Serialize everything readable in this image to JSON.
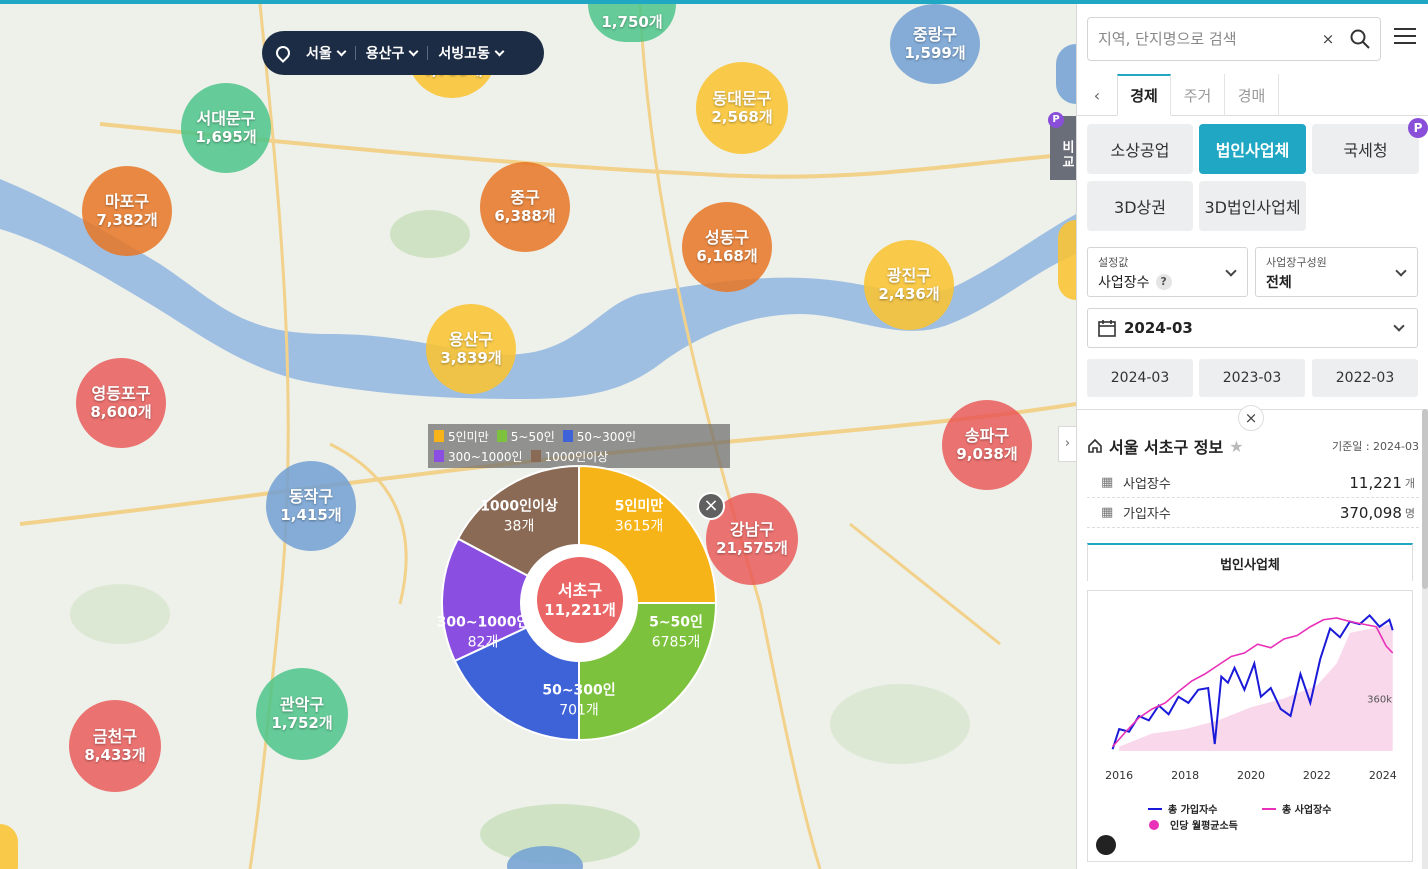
{
  "location": {
    "city": "서울",
    "district": "용산구",
    "dong": "서빙고동"
  },
  "map_bubbles": [
    {
      "name": "서대문구",
      "count": "1,695개",
      "color": "green"
    },
    {
      "name": "마포구",
      "count": "7,382개",
      "color": "orange"
    },
    {
      "name": "중구",
      "count": "6,388개",
      "color": "orange"
    },
    {
      "name": "동대문구",
      "count": "2,568개",
      "color": "yellow"
    },
    {
      "name": "성동구",
      "count": "6,168개",
      "color": "orange"
    },
    {
      "name": "중랑구",
      "count": "1,599개",
      "color": "blue"
    },
    {
      "name": "광진구",
      "count": "2,436개",
      "color": "yellow"
    },
    {
      "name": "용산구",
      "count": "3,839개",
      "color": "yellow"
    },
    {
      "name": "영등포구",
      "count": "8,600개",
      "color": "red"
    },
    {
      "name": "송파구",
      "count": "9,038개",
      "color": "red"
    },
    {
      "name": "동작구",
      "count": "1,415개",
      "color": "blue"
    },
    {
      "name": "강남구",
      "count": "21,575개",
      "color": "red"
    },
    {
      "name": "관악구",
      "count": "1,752개",
      "color": "green"
    },
    {
      "name": "금천구",
      "count": "8,433개",
      "color": "red"
    },
    {
      "name": "",
      "count": "4,785개",
      "color": "yellow"
    },
    {
      "name": "",
      "count": "1,750개",
      "color": "green"
    }
  ],
  "legend": [
    {
      "label": "5인미만",
      "color": "#f6b418"
    },
    {
      "label": "5~50인",
      "color": "#7cc23c"
    },
    {
      "label": "50~300인",
      "color": "#3e62d8"
    },
    {
      "label": "300~1000인",
      "color": "#8a4fe0"
    },
    {
      "label": "1000인이상",
      "color": "#8b6a55"
    }
  ],
  "donut": {
    "district": "서초구",
    "total": "11,221개",
    "segments": [
      {
        "label": "5인미만",
        "value_text": "3615개",
        "value": 3615,
        "color": "#f6b418"
      },
      {
        "label": "5~50인",
        "value_text": "6785개",
        "value": 6785,
        "color": "#7cc23c"
      },
      {
        "label": "50~300인",
        "value_text": "701개",
        "value": 701,
        "color": "#3e62d8"
      },
      {
        "label": "300~1000인",
        "value_text": "82개",
        "value": 82,
        "color": "#8a4fe0"
      },
      {
        "label": "1000인이상",
        "value_text": "38개",
        "value": 38,
        "color": "#8b6a55"
      }
    ]
  },
  "compare_label": "비교",
  "search": {
    "placeholder": "지역, 단지명으로 검색"
  },
  "tabs": [
    "경제",
    "주거",
    "경매"
  ],
  "categories": [
    "소상공업",
    "법인사업체",
    "국세청",
    "3D상권",
    "3D법인사업체"
  ],
  "setting": {
    "label": "설정값",
    "value": "사업장수"
  },
  "member": {
    "label": "사업장구성원",
    "value": "전체"
  },
  "date": {
    "selected": "2024-03",
    "quick": [
      "2024-03",
      "2023-03",
      "2022-03"
    ]
  },
  "info": {
    "title": "서울 서초구 정보",
    "base_date": "기준일 : 2024-03",
    "rows": [
      {
        "label": "사업장수",
        "value": "11,221",
        "unit": "개"
      },
      {
        "label": "가입자수",
        "value": "370,098",
        "unit": "명"
      }
    ]
  },
  "chart_tab": "법인사업체",
  "colors": {
    "accent": "#1fa7c4",
    "series_blue": "#1a1ad8",
    "series_pink": "#e830b8",
    "income_fill": "#f7c8e4"
  },
  "chart_data": {
    "type": "line",
    "x_ticks": [
      "2016",
      "2018",
      "2020",
      "2022",
      "2024"
    ],
    "y_tick_labels": [
      "360k"
    ],
    "xlim": [
      2015.6,
      2024.4
    ],
    "series": [
      {
        "name": "총 가입자수",
        "color": "#1a1ad8",
        "x": [
          2015.8,
          2016.0,
          2016.3,
          2016.6,
          2016.9,
          2017.2,
          2017.5,
          2017.8,
          2018.1,
          2018.4,
          2018.7,
          2018.9,
          2019.1,
          2019.3,
          2019.5,
          2019.8,
          2020.1,
          2020.3,
          2020.6,
          2020.9,
          2021.2,
          2021.5,
          2021.8,
          2022.1,
          2022.4,
          2022.7,
          2023.0,
          2023.3,
          2023.6,
          2023.9,
          2024.2,
          2024.3
        ],
        "y": [
          0.02,
          0.25,
          0.22,
          0.4,
          0.35,
          0.52,
          0.42,
          0.62,
          0.55,
          0.7,
          0.72,
          0.08,
          0.85,
          0.78,
          0.95,
          0.7,
          1.0,
          0.62,
          0.72,
          0.48,
          0.4,
          0.88,
          0.55,
          1.05,
          1.4,
          1.3,
          1.48,
          1.45,
          1.55,
          1.42,
          1.5,
          1.38
        ]
      },
      {
        "name": "총 사업장수",
        "color": "#e830b8",
        "x": [
          2015.8,
          2016.2,
          2016.6,
          2017.0,
          2017.4,
          2017.8,
          2018.2,
          2018.6,
          2019.0,
          2019.4,
          2019.8,
          2020.2,
          2020.6,
          2021.0,
          2021.4,
          2021.8,
          2022.2,
          2022.6,
          2023.0,
          2023.4,
          2023.8,
          2024.1,
          2024.3
        ],
        "y": [
          0.05,
          0.22,
          0.38,
          0.48,
          0.55,
          0.68,
          0.8,
          0.88,
          0.98,
          1.08,
          1.12,
          1.22,
          1.18,
          1.28,
          1.32,
          1.42,
          1.5,
          1.52,
          1.48,
          1.45,
          1.42,
          1.2,
          1.12
        ]
      }
    ],
    "area": {
      "name": "인당 월평균소득"
    },
    "legend_placement": "bottom"
  }
}
